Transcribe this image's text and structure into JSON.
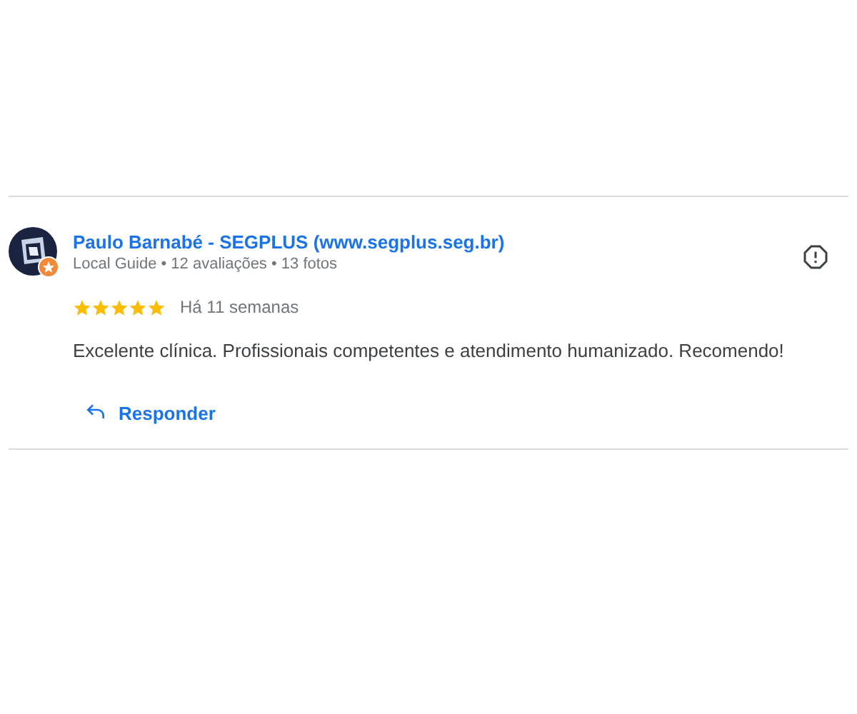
{
  "review": {
    "author": "Paulo Barnabé - SEGPLUS (www.segplus.seg.br)",
    "meta": "Local Guide • 12 avaliações • 13 fotos",
    "stars": 5,
    "time": "Há 11 semanas",
    "text": "Excelente clínica. Profissionais competentes e atendimento humanizado. Recomendo!",
    "reply_label": "Responder"
  }
}
